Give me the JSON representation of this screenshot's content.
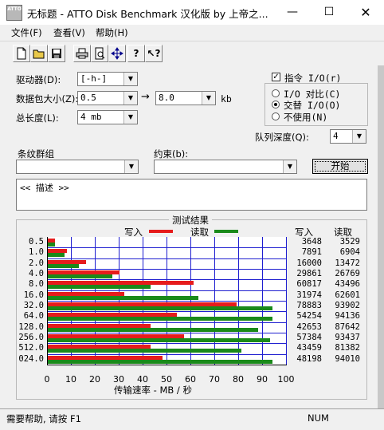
{
  "window": {
    "title": "无标题 - ATTO Disk Benchmark  汉化版 by 上帝之...",
    "app_icon_text": "ATTO",
    "minimize_icon": "minimize-icon",
    "maximize_icon": "maximize-icon",
    "close_icon": "close-icon"
  },
  "menu": {
    "file": "文件(F)",
    "view": "查看(V)",
    "help": "帮助(H)"
  },
  "toolbar": [
    "new-icon",
    "open-icon",
    "save-icon",
    "print-icon",
    "print-preview-icon",
    "move-icon",
    "help-icon",
    "context-help-icon"
  ],
  "settings": {
    "drive_label": "驱动器(D):",
    "drive_value": "[-h-]",
    "size_label": "数据包大小(Z):",
    "size_from": "0.5",
    "size_to": "8.0",
    "size_unit": "kb",
    "length_label": "总长度(L):",
    "length_value": "4 mb",
    "direct_io_label": "指令 I/O(r)",
    "direct_io_checked": true,
    "io_compare": "I/O 对比(C)",
    "overlapped": "交替 I/O(O)",
    "neither": "不使用(N)",
    "queue_label": "队列深度(Q):",
    "queue_value": "4",
    "stripe_label": "条纹群组",
    "constraint_label": "约束(b):",
    "start_button": "开始",
    "description": "<< 描述 >>"
  },
  "results": {
    "group_title": "测试结果",
    "write_legend": "写入",
    "read_legend": "读取",
    "write_header": "写入",
    "read_header": "读取",
    "x_axis_label": "传输速率 - MB / 秒",
    "x_ticks": [
      "0",
      "10",
      "20",
      "30",
      "40",
      "50",
      "60",
      "70",
      "80",
      "90",
      "100"
    ]
  },
  "chart_data": {
    "type": "bar",
    "categories": [
      "0.5",
      "1.0",
      "2.0",
      "4.0",
      "8.0",
      "16.0",
      "32.0",
      "64.0",
      "128.0",
      "256.0",
      "512.0",
      "024.0"
    ],
    "xlabel": "传输速率 - MB / 秒",
    "xlim": [
      0,
      100
    ],
    "series": [
      {
        "name": "写入",
        "color": "#e61c1c",
        "bar_values": [
          3,
          8,
          16,
          30,
          61,
          32,
          79,
          54,
          43,
          57,
          43,
          48
        ],
        "values": [
          "3648",
          "7891",
          "16000",
          "29861",
          "60817",
          "31974",
          "78883",
          "54254",
          "42653",
          "57384",
          "43459",
          "48198"
        ]
      },
      {
        "name": "读取",
        "color": "#1a8a1a",
        "bar_values": [
          3,
          7,
          13,
          27,
          43,
          63,
          94,
          94,
          88,
          93,
          81,
          94
        ],
        "values": [
          "3529",
          "6904",
          "13472",
          "26769",
          "43496",
          "62601",
          "93902",
          "94136",
          "87642",
          "93437",
          "81382",
          "94010"
        ]
      }
    ]
  },
  "status": {
    "help_text": "需要帮助, 请按 F1",
    "num": "NUM"
  }
}
